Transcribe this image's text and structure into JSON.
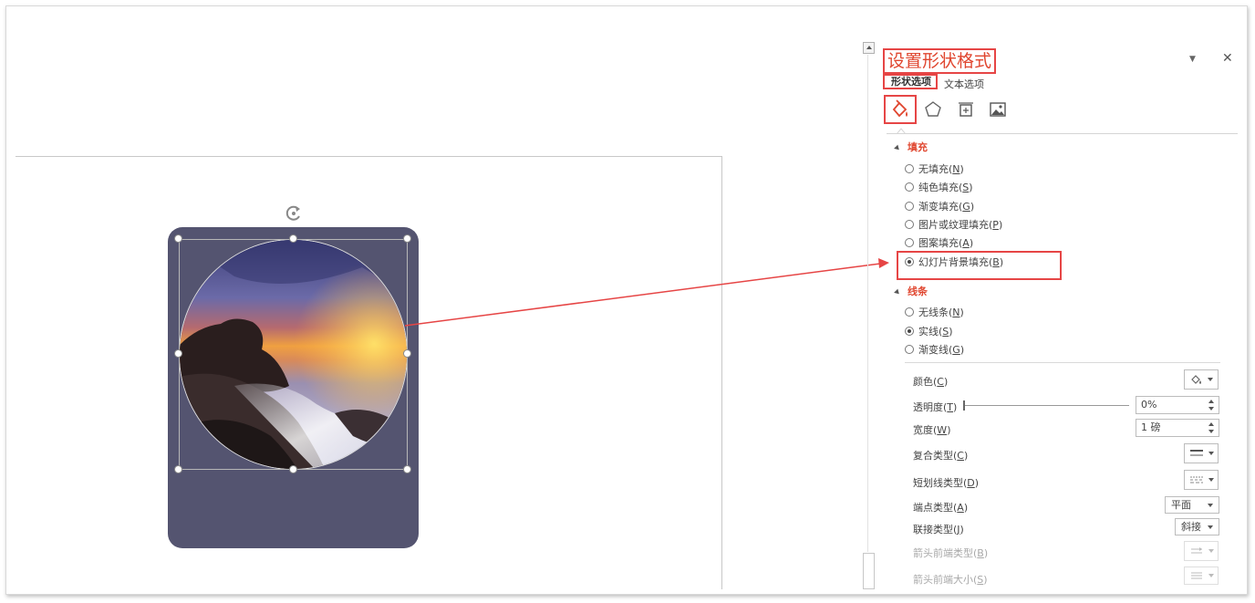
{
  "pane": {
    "title": "设置形状格式",
    "tabs": [
      "形状选项",
      "文本选项"
    ],
    "icons": [
      "fill-line-icon",
      "effects-pentagon-icon",
      "size-properties-icon",
      "picture-icon"
    ]
  },
  "fill": {
    "heading": "填充",
    "options": [
      {
        "label": "无填充(",
        "key": "N",
        "selected": false
      },
      {
        "label": "纯色填充(",
        "key": "S",
        "selected": false
      },
      {
        "label": "渐变填充(",
        "key": "G",
        "selected": false
      },
      {
        "label": "图片或纹理填充(",
        "key": "P",
        "selected": false
      },
      {
        "label": "图案填充(",
        "key": "A",
        "selected": false
      },
      {
        "label": "幻灯片背景填充(",
        "key": "B",
        "selected": true
      }
    ]
  },
  "line": {
    "heading": "线条",
    "options": [
      {
        "label": "无线条(",
        "key": "N",
        "selected": false
      },
      {
        "label": "实线(",
        "key": "S",
        "selected": true
      },
      {
        "label": "渐变线(",
        "key": "G",
        "selected": false
      }
    ],
    "props": {
      "color": {
        "label": "颜色(",
        "key": "C"
      },
      "transparency": {
        "label": "透明度(",
        "key": "T",
        "value": "0%",
        "level": 0
      },
      "width": {
        "label": "宽度(",
        "key": "W",
        "value": "1 磅"
      },
      "compound": {
        "label": "复合类型(",
        "key": "C"
      },
      "dash": {
        "label": "短划线类型(",
        "key": "D"
      },
      "cap": {
        "label": "端点类型(",
        "key": "A",
        "value": "平面"
      },
      "join": {
        "label": "联接类型(",
        "key": "J",
        "value": "斜接"
      },
      "arrow_begin_type": {
        "label": "箭头前端类型(",
        "key": "B"
      },
      "arrow_begin_size": {
        "label": "箭头前端大小(",
        "key": "S"
      }
    }
  },
  "colors": {
    "accent_red": "#e64545",
    "heading_orange": "#e0462f",
    "card": "#545470"
  }
}
